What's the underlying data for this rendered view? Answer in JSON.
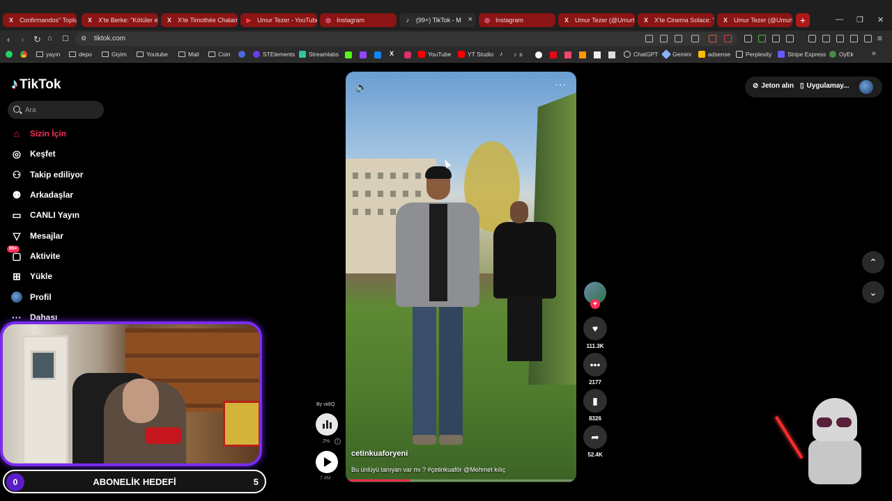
{
  "browser": {
    "tabs": [
      {
        "label": "Confirmandos\" Toplulu",
        "icon": "x-logo-icon"
      },
      {
        "label": "X'te Berke: \"Kötüler es",
        "icon": "x-logo-icon"
      },
      {
        "label": "X'te Timothée Chalam",
        "icon": "x-logo-icon"
      },
      {
        "label": "Umur Tezer - YouTube",
        "icon": "youtube-icon"
      },
      {
        "label": "Instagram",
        "icon": "instagram-icon"
      },
      {
        "label": "(99+) TikTok - M",
        "icon": "tiktok-icon"
      },
      {
        "label": "Instagram",
        "icon": "instagram-icon"
      },
      {
        "label": "Umur Tezer (@Umurte",
        "icon": "x-logo-icon"
      },
      {
        "label": "X'te Cinema Solace: \"N",
        "icon": "x-logo-icon"
      },
      {
        "label": "Umur Tezer (@Umurte",
        "icon": "x-logo-icon"
      }
    ],
    "url": "tiktok.com",
    "bookmarks": [
      {
        "label": "",
        "icon": "whatsapp-icon"
      },
      {
        "label": "",
        "icon": "chrome-icon"
      },
      {
        "label": "yayın",
        "icon": "folder-icon"
      },
      {
        "label": "depo",
        "icon": "folder-icon"
      },
      {
        "label": "Giyim",
        "icon": "folder-icon"
      },
      {
        "label": "Youtube",
        "icon": "folder-icon"
      },
      {
        "label": "Mail",
        "icon": "folder-icon"
      },
      {
        "label": "Coin",
        "icon": "folder-icon"
      },
      {
        "label": "",
        "icon": "r-icon"
      },
      {
        "label": "STElements",
        "icon": "ste-icon"
      },
      {
        "label": "Streamlabs",
        "icon": "streamlabs-icon"
      },
      {
        "label": "YouTube",
        "icon": "youtube-icon"
      },
      {
        "label": "YT Studio",
        "icon": "yt-studio-icon"
      },
      {
        "label": "s",
        "icon": "tiktok-icon"
      },
      {
        "label": "ChatGPT",
        "icon": "chatgpt-icon"
      },
      {
        "label": "Gemini",
        "icon": "gemini-icon"
      },
      {
        "label": "adsense",
        "icon": "adsense-icon"
      },
      {
        "label": "Perplexity",
        "icon": "perplexity-icon"
      },
      {
        "label": "Stripe Express",
        "icon": "stripe-icon"
      },
      {
        "label": "OyEk",
        "icon": "oyek-icon"
      }
    ]
  },
  "tiktok": {
    "logo": "TikTok",
    "search_placeholder": "Ara",
    "nav": [
      {
        "label": "Sizin İçin",
        "icon": "home-icon",
        "active": true
      },
      {
        "label": "Keşfet",
        "icon": "compass-icon"
      },
      {
        "label": "Takip ediliyor",
        "icon": "following-icon"
      },
      {
        "label": "Arkadaşlar",
        "icon": "friends-icon"
      },
      {
        "label": "CANLI Yayın",
        "icon": "live-icon"
      },
      {
        "label": "Mesajlar",
        "icon": "messages-icon"
      },
      {
        "label": "Aktivite",
        "icon": "activity-icon",
        "badge": "99+"
      },
      {
        "label": "Yükle",
        "icon": "upload-icon"
      },
      {
        "label": "Profil",
        "icon": "profile-icon"
      },
      {
        "label": "Dahası",
        "icon": "more-icon"
      }
    ],
    "top_right": {
      "coins": "Jeton alın",
      "app": "Uygulamay..."
    },
    "video": {
      "username": "cetinkuaforyeni",
      "caption": "Bu ünlüyü tanıyan var mı ? #çetinkuaför @Mehmet kılıç",
      "progress": 0.28
    },
    "actions": {
      "likes": "111.3K",
      "comments": "2177",
      "saves": "8326",
      "shares": "52.4K"
    },
    "vidiq": {
      "label": "By vidIQ",
      "percent": "2%",
      "views": "7.4M"
    }
  },
  "overlay": {
    "goal_label": "ABONELİK HEDEFİ",
    "goal_current": "0",
    "goal_target": "5",
    "accent_purple": "#7b2cf0",
    "tiktok_red": "#fe2c55",
    "tab_red": "#8b1414"
  }
}
